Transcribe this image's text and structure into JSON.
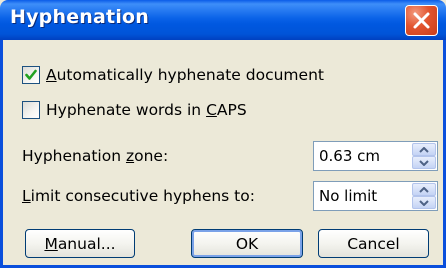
{
  "window": {
    "title": "Hyphenation"
  },
  "options": {
    "auto_hyphenate": {
      "label_pre": "",
      "label_underlined": "A",
      "label_post": "utomatically hyphenate document",
      "checked": true
    },
    "hyphenate_caps": {
      "label_pre": "Hyphenate words in ",
      "label_underlined": "C",
      "label_post": "APS",
      "checked": false
    }
  },
  "fields": {
    "zone": {
      "label_pre": "Hyphenation ",
      "label_underlined": "z",
      "label_post": "one:",
      "value": "0.63 cm"
    },
    "consecutive": {
      "label_pre": "",
      "label_underlined": "L",
      "label_post": "imit consecutive hyphens to:",
      "value": "No limit"
    }
  },
  "buttons": {
    "manual": {
      "label_pre": "",
      "label_underlined": "M",
      "label_post": "anual..."
    },
    "ok": "OK",
    "cancel": "Cancel"
  },
  "colors": {
    "titlebar": "#0058e0",
    "dialog_bg": "#ece9d8",
    "close_button": "#e2542e",
    "checkmark": "#21a121"
  }
}
